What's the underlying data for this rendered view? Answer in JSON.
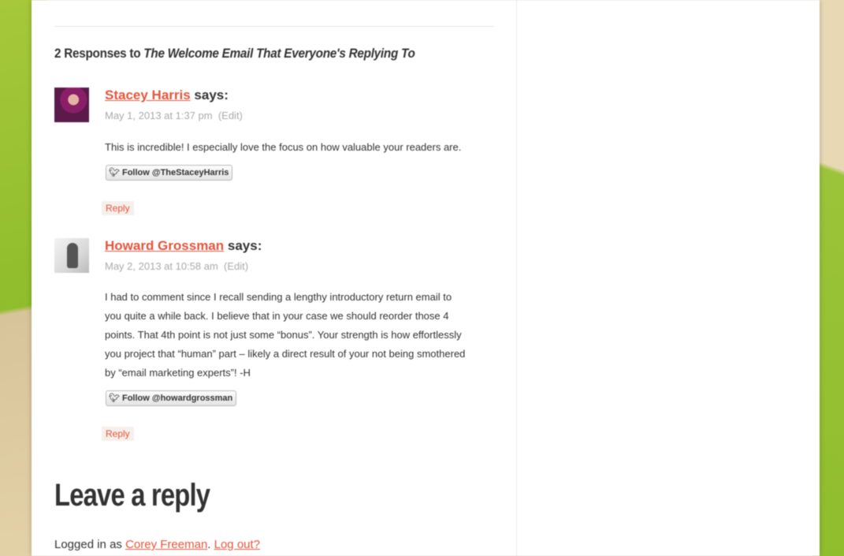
{
  "comments_section": {
    "count_prefix": "2 Responses to ",
    "post_title": "The Welcome Email That Everyone's Replying To"
  },
  "comments": [
    {
      "author": "Stacey Harris",
      "says": "says:",
      "date": "May 1, 2013 at 1:37 pm",
      "edit_label": "(Edit)",
      "body": [
        "This is incredible! I especially love the focus on how valuable your readers are."
      ],
      "follow_label": "Follow @TheStaceyHarris",
      "reply_label": "Reply"
    },
    {
      "author": "Howard Grossman",
      "says": "says:",
      "date": "May 2, 2013 at 10:58 am",
      "edit_label": "(Edit)",
      "body": [
        "I had to comment since I recall sending a lengthy introductory return email to",
        "you quite a while back. I believe that in your case we should reorder those 4",
        "points. That 4th point is not just some “bonus”. Your strength is how effortlessly",
        "you project that “human” part – likely a direct result of your not being smothered",
        "by “email marketing experts”! -H"
      ],
      "follow_label": "Follow @howardgrossman",
      "reply_label": "Reply"
    }
  ],
  "reply_form": {
    "title": "Leave a reply",
    "logged_in_prefix": "Logged in as ",
    "user_name": "Corey Freeman",
    "separator": ".",
    "logout_label": "Log out?"
  },
  "icons": {
    "twitter_bird": "twitter-icon"
  },
  "colors": {
    "link": "#e2553b",
    "text": "#333333",
    "meta": "#aaaaaa"
  }
}
